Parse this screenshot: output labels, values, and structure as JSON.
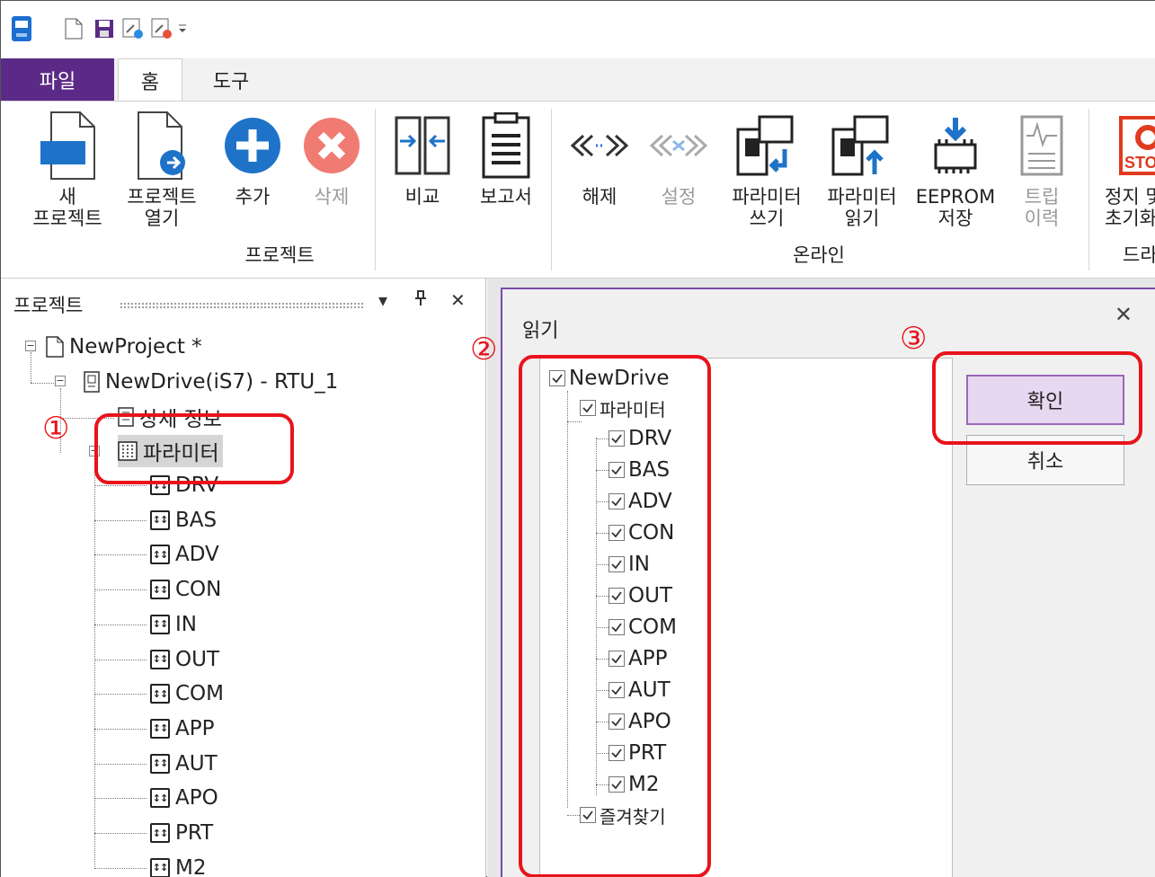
{
  "ribbon_tabs": {
    "file": "파일",
    "home": "홈",
    "tools": "도구"
  },
  "ribbon": {
    "new_project": "새\n프로젝트",
    "open_project": "프로젝트\n열기",
    "add": "추가",
    "delete": "삭제",
    "compare": "비교",
    "report": "보고서",
    "disconnect": "해제",
    "connect": "설정",
    "write_params": "파라미터\n쓰기",
    "read_params": "파라미터\n읽기",
    "eeprom_save": "EEPROM\n저장",
    "trip_history": "트립\n이력",
    "stop_reset": "정지 및\n초기화",
    "stop_badge": "STOP",
    "groups": {
      "project": "프로젝트",
      "online": "온라인",
      "drive": "드라이브"
    }
  },
  "project_panel": {
    "title": "프로젝트",
    "tree": {
      "project": "NewProject *",
      "drive": "NewDrive(iS7) - RTU_1",
      "detail_info": "상세 정보",
      "parameters": "파라미터",
      "groups": [
        "DRV",
        "BAS",
        "ADV",
        "CON",
        "IN",
        "OUT",
        "COM",
        "APP",
        "AUT",
        "APO",
        "PRT",
        "M2"
      ]
    }
  },
  "dialog": {
    "title": "읽기",
    "close_glyph": "✕",
    "root": "NewDrive",
    "parameters": "파라미터",
    "groups": [
      "DRV",
      "BAS",
      "ADV",
      "CON",
      "IN",
      "OUT",
      "COM",
      "APP",
      "AUT",
      "APO",
      "PRT",
      "M2"
    ],
    "favorites": "즐겨찾기",
    "ok_label": "확인",
    "cancel_label": "취소"
  },
  "annotations": {
    "step1": "①",
    "step2": "②",
    "step3": "③"
  },
  "colors": {
    "accent": "#5b2a86",
    "annotation": "#e8131b",
    "ok_button": "#e8d7f0",
    "add_icon": "#1e73c8",
    "delete_icon": "#f07b72"
  }
}
